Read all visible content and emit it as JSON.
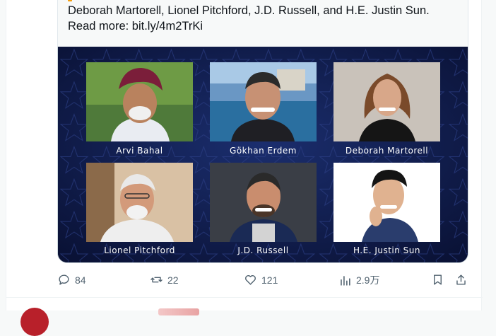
{
  "post": {
    "text_line1": "Deborah Martorell, Lionel Pitchford, J.D. Russell, and H.E. Justin Sun.",
    "text_line2": "Read more: bit.ly/4m2TrKi"
  },
  "media": {
    "people": [
      {
        "name": "Arvi Bahal"
      },
      {
        "name": "Gökhan Erdem"
      },
      {
        "name": "Deborah Martorell"
      },
      {
        "name": "Lionel Pitchford"
      },
      {
        "name": "J.D. Russell"
      },
      {
        "name": "H.E. Justin Sun"
      }
    ]
  },
  "actions": {
    "replies": "84",
    "reposts": "22",
    "likes": "121",
    "views": "2.9万"
  },
  "colors": {
    "background": "#0b1640",
    "icon_gray": "#536471",
    "text": "#0f1419"
  }
}
